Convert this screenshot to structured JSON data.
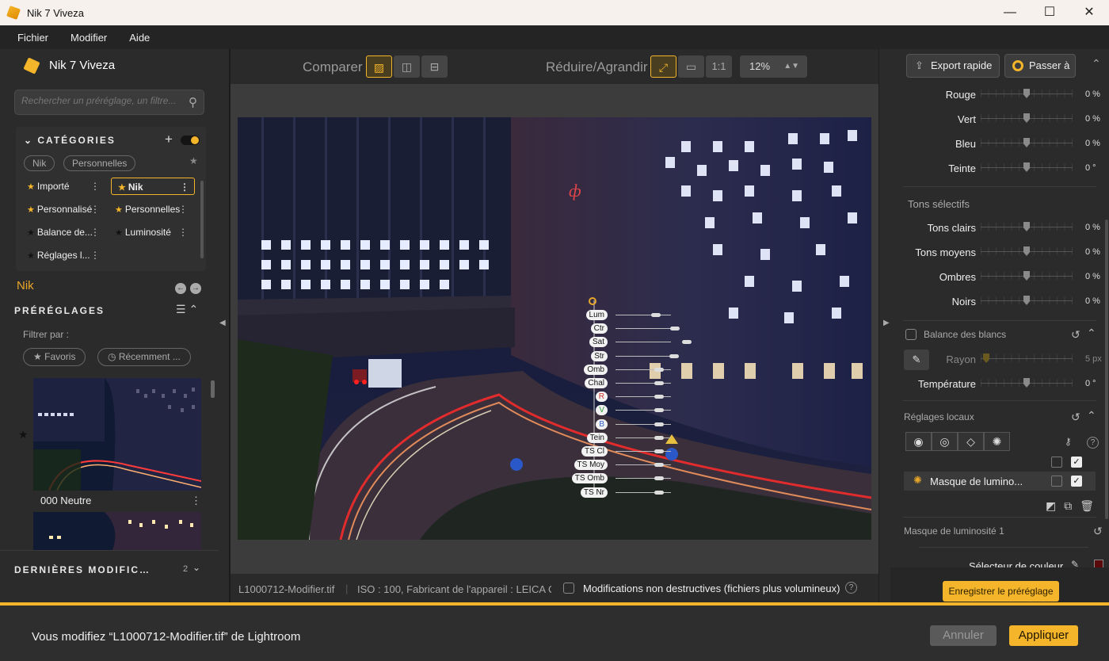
{
  "window": {
    "title": "Nik 7 Viveza",
    "controls": [
      "—",
      "☐",
      "✕"
    ]
  },
  "menu": [
    "Fichier",
    "Modifier",
    "Aide"
  ],
  "left": {
    "brand": "Nik 7 Viveza",
    "search_placeholder": "Rechercher un préréglage, un filtre...",
    "categories": {
      "title": "CATÉGORIES",
      "chips": [
        "Nik",
        "Personnelles"
      ],
      "items": [
        {
          "label": "Importé",
          "star": "gold",
          "selected": false
        },
        {
          "label": "Nik",
          "star": "gold",
          "selected": true
        },
        {
          "label": "Personnalisé",
          "star": "gold",
          "selected": false
        },
        {
          "label": "Personnelles",
          "star": "gold",
          "selected": false
        },
        {
          "label": "Balance de...",
          "star": "dark",
          "selected": false
        },
        {
          "label": "Luminosité",
          "star": "dark",
          "selected": false
        },
        {
          "label": "Réglages l...",
          "star": "dark",
          "selected": false
        }
      ]
    },
    "source_label": "Nik",
    "presets": {
      "title": "PRÉRÉGLAGES",
      "filter_label": "Filtrer par :",
      "filters": [
        "Favoris",
        "Récemment ..."
      ],
      "first_name": "000 Neutre"
    },
    "last_changes": {
      "title": "DERNIÈRES MODIFIC…",
      "count": "2"
    }
  },
  "center": {
    "compare_label": "Comparer",
    "zoom_label": "Réduire/Agrandir",
    "one_to_one": "1:1",
    "zoom_value": "12%",
    "control_point_labels": [
      "Lum",
      "Ctr",
      "Sat",
      "Str",
      "Omb",
      "Chal",
      "R",
      "V",
      "B",
      "Tein",
      "TS Cl",
      "TS Moy",
      "TS Omb",
      "TS Nr"
    ],
    "status": {
      "filename": "L1000712-Modifier.tif",
      "meta": "ISO : 100, Fabricant de l'appareil : LEICA C...",
      "nondestructive": "Modifications non destructives (fichiers plus volumineux)",
      "help": "?"
    }
  },
  "right": {
    "export_label": "Export rapide",
    "switch_label": "Passer à",
    "color_sliders": [
      {
        "label": "Rouge",
        "value": "0 %"
      },
      {
        "label": "Vert",
        "value": "0 %"
      },
      {
        "label": "Bleu",
        "value": "0 %"
      },
      {
        "label": "Teinte",
        "value": "0 °"
      }
    ],
    "selective_title": "Tons sélectifs",
    "selective_sliders": [
      {
        "label": "Tons clairs",
        "value": "0 %"
      },
      {
        "label": "Tons moyens",
        "value": "0 %"
      },
      {
        "label": "Ombres",
        "value": "0 %"
      },
      {
        "label": "Noirs",
        "value": "0 %"
      }
    ],
    "wb": {
      "title": "Balance des blancs",
      "radius_label": "Rayon",
      "radius_value": "5 px",
      "temp_label": "Température",
      "temp_value": "0 °"
    },
    "local": {
      "title": "Réglages locaux",
      "mask_name": "Masque de lumino...",
      "mask_section": "Masque de luminosité 1",
      "next_hint": "Sélecteur de couleur"
    },
    "save_preset": "Enregistrer le préréglage"
  },
  "bottom": {
    "message": "Vous modifiez “L1000712-Modifier.tif” de Lightroom",
    "cancel": "Annuler",
    "apply": "Appliquer"
  },
  "colors": {
    "accent": "#f5b52a",
    "bg": "#2b2b2b"
  }
}
